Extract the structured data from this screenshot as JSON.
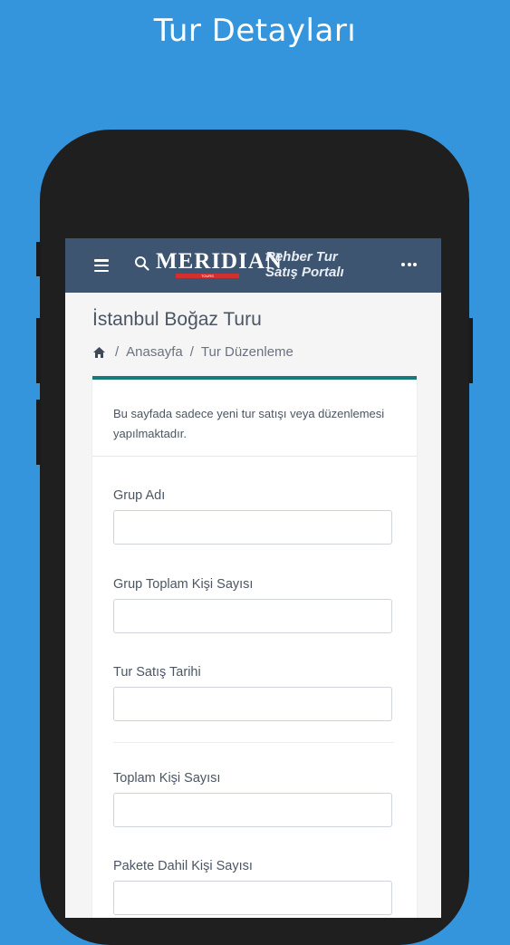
{
  "promo": {
    "title": "Tur Detayları"
  },
  "navbar": {
    "logo_text": "MERIDIAN",
    "logo_sub": "TOURS",
    "portal_line1": "Rehber Tur",
    "portal_line2": "Satış Portalı"
  },
  "page": {
    "title": "İstanbul Boğaz Turu",
    "breadcrumb": [
      "Anasayfa",
      "Tur Düzenleme"
    ],
    "breadcrumb_sep": "/"
  },
  "form": {
    "notice": "Bu sayfada sadece yeni tur satışı veya düzenlemesi yapılmaktadır.",
    "fields": [
      {
        "label": "Grup Adı",
        "value": ""
      },
      {
        "label": "Grup Toplam Kişi Sayısı",
        "value": ""
      },
      {
        "label": "Tur Satış Tarihi",
        "value": ""
      },
      {
        "label": "Toplam Kişi Sayısı",
        "value": ""
      },
      {
        "label": "Pakete Dahil Kişi Sayısı",
        "value": ""
      }
    ]
  },
  "colors": {
    "background": "#3595dc",
    "navbar": "#3e5571",
    "card_accent": "#167a7a"
  },
  "icons": [
    "hamburger-icon",
    "search-icon",
    "more-icon",
    "home-icon"
  ]
}
